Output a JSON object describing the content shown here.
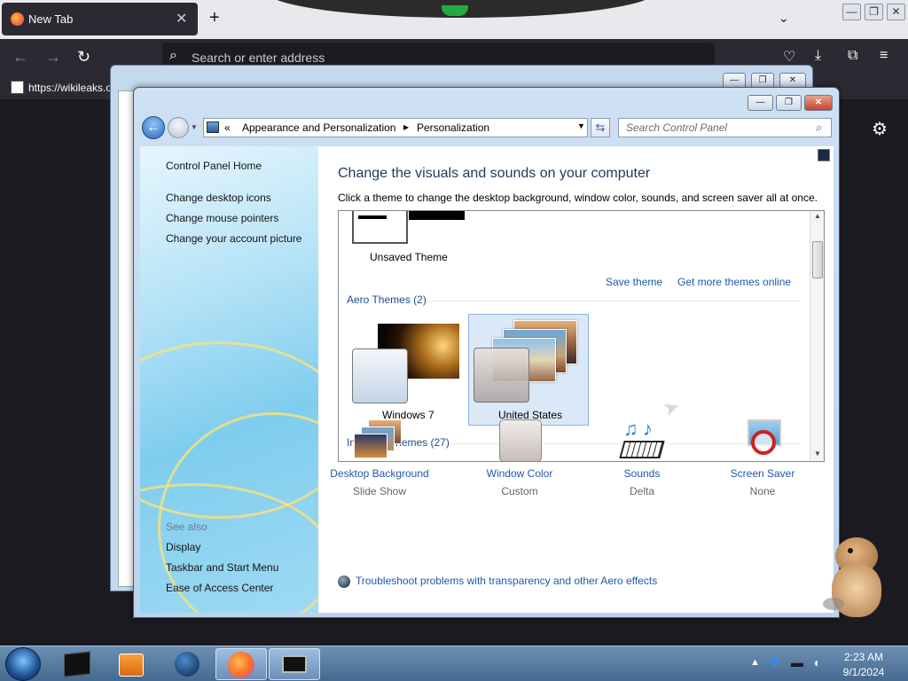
{
  "browser": {
    "tab_title": "New Tab",
    "tab_close": "✕",
    "new_tab": "+",
    "url_placeholder": "Search or enter address",
    "bookmark_url": "https://wikileaks.o"
  },
  "window": {
    "minimize": "—",
    "maximize": "❐",
    "close": "✕"
  },
  "address_bar": {
    "chevron": "«",
    "crumb1": "Appearance and Personalization",
    "separator": "▸",
    "crumb2": "Personalization",
    "search_placeholder": "Search Control Panel"
  },
  "left_panel": {
    "home": "Control Panel Home",
    "links": [
      "Change desktop icons",
      "Change mouse pointers",
      "Change your account picture"
    ],
    "see_also": "See also",
    "see_also_links": [
      "Display",
      "Taskbar and Start Menu",
      "Ease of Access Center"
    ]
  },
  "content": {
    "heading": "Change the visuals and sounds on your computer",
    "subheading": "Click a theme to change the desktop background, window color, sounds, and screen saver all at once.",
    "unsaved_theme": "Unsaved Theme",
    "save_theme": "Save theme",
    "get_more": "Get more themes online",
    "aero_group": "Aero Themes (2)",
    "themes": [
      "Windows 7",
      "United States"
    ],
    "selected_theme": "United States",
    "installed_group": "Installed Themes (27)",
    "troubleshoot": "Troubleshoot problems with transparency and other Aero effects"
  },
  "bottom_items": [
    {
      "name": "Desktop Background",
      "value": "Slide Show"
    },
    {
      "name": "Window Color",
      "value": "Custom"
    },
    {
      "name": "Sounds",
      "value": "Delta"
    },
    {
      "name": "Screen Saver",
      "value": "None"
    }
  ],
  "taskbar": {
    "time": "2:23 AM",
    "date": "9/1/2024"
  },
  "colors": {
    "link": "#1e5aa8",
    "heading": "#1e395b",
    "firefox_dark": "#2b2a33"
  }
}
